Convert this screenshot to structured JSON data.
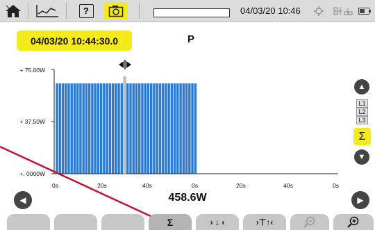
{
  "topbar": {
    "icons": [
      "home-icon",
      "trend-curve-icon",
      "help-icon",
      "snapshot-icon"
    ],
    "help_label": "?",
    "datetime": "04/03/20 10:46",
    "status_icons": [
      "gps-icon",
      "network-icon",
      "battery-icon"
    ]
  },
  "header": {
    "timestamp": "04/03/20 10:44:30.0",
    "parameter": "P"
  },
  "chart_data": {
    "type": "bar",
    "y_ticks": [
      "+ 75.00W",
      "+ 37.50W",
      "+. 0000W"
    ],
    "ylim": [
      0,
      75
    ],
    "x_ticks": [
      "0s",
      "20s",
      "40s",
      "0s",
      "20s",
      "40s",
      "0s"
    ],
    "bar_value": 65.0,
    "bar_count": 48,
    "bars_visible_fraction": 0.5,
    "cursor_index": 23,
    "color": "#2b7bd0"
  },
  "cursor": {
    "value": "458.6W"
  },
  "side": {
    "phases": [
      "L1",
      "L2",
      "L3"
    ],
    "sum_label": "Σ"
  },
  "fkeys": {
    "sum_label": "Σ",
    "goto_min_label": "› ↓ ‹",
    "goto_max_label": "›⊤↑‹",
    "zoom_out_icon": "zoom-out-icon",
    "zoom_in_icon": "zoom-in-icon"
  },
  "colors": {
    "accent_yellow": "#f5ea1c",
    "bar_blue": "#2b7bd0",
    "annotation_red": "#c41230"
  }
}
